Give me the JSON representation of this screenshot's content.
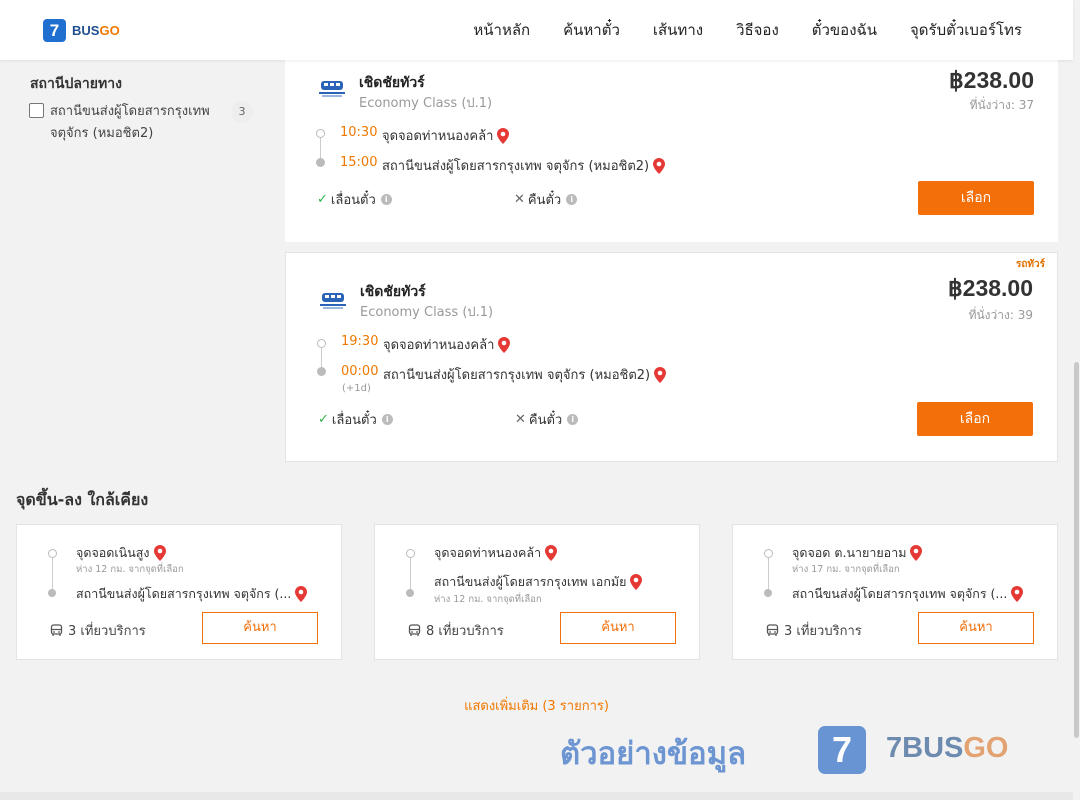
{
  "header": {
    "logo_digit": "7",
    "logo_text": "BUS",
    "logo_text_accent": "GO",
    "nav": [
      "หน้าหลัก",
      "ค้นหาตั๋ว",
      "เส้นทาง",
      "วิธีจอง",
      "ตั๋วของฉัน",
      "จุดรับตั๋วเบอร์โทร"
    ]
  },
  "filter": {
    "title": "สถานีปลายทาง",
    "options": [
      {
        "label": "สถานีขนส่งผู้โดยสารกรุงเทพ จตุจักร (หมอชิต2)",
        "count": "3",
        "checked": false
      }
    ]
  },
  "trips": [
    {
      "operator": "เชิดชัยทัวร์",
      "class": "Economy Class (ป.1)",
      "price": "฿238.00",
      "seats": "ที่นั่งว่าง: 37",
      "tag": "",
      "depart_time": "10:30",
      "depart_stop": "จุดจอดท่าหนองคล้า",
      "arrive_time": "15:00",
      "arrive_stop": "สถานีขนส่งผู้โดยสารกรุงเทพ จตุจักร (หมอชิต2)",
      "next_day": "",
      "reschedule": "เลื่อนตั๋ว",
      "refund": "คืนตั๋ว",
      "select": "เลือก"
    },
    {
      "operator": "เชิดชัยทัวร์",
      "class": "Economy Class (ป.1)",
      "price": "฿238.00",
      "seats": "ที่นั่งว่าง: 39",
      "tag": "รถทัวร์",
      "depart_time": "19:30",
      "depart_stop": "จุดจอดท่าหนองคล้า",
      "arrive_time": "00:00",
      "arrive_stop": "สถานีขนส่งผู้โดยสารกรุงเทพ จตุจักร (หมอชิต2)",
      "next_day": "(+1d)",
      "reschedule": "เลื่อนตั๋ว",
      "refund": "คืนตั๋ว",
      "select": "เลือก"
    }
  ],
  "nearby": {
    "title": "จุดขึ้น-ลง ใกล้เคียง",
    "cards": [
      {
        "from": "จุดจอดเนินสูง",
        "from_sub": "ห่าง 12 กม. จากจุดที่เลือก",
        "to": "สถานีขนส่งผู้โดยสารกรุงเทพ จตุจักร (...",
        "to_sub": "",
        "trips": "3 เที่ยวบริการ",
        "button": "ค้นหา"
      },
      {
        "from": "จุดจอดท่าหนองคล้า",
        "from_sub": "",
        "to": "สถานีขนส่งผู้โดยสารกรุงเทพ เอกมัย",
        "to_sub": "ห่าง 12 กม. จากจุดที่เลือก",
        "trips": "8 เที่ยวบริการ",
        "button": "ค้นหา"
      },
      {
        "from": "จุดจอด ต.นายายอาม",
        "from_sub": "ห่าง 17 กม. จากจุดที่เลือก",
        "to": "สถานีขนส่งผู้โดยสารกรุงเทพ จตุจักร (...",
        "to_sub": "",
        "trips": "3 เที่ยวบริการ",
        "button": "ค้นหา"
      }
    ],
    "show_more": "แสดงเพิ่มเติม (3 รายการ)"
  },
  "watermark": {
    "text": "ตัวอย่างข้อมูล",
    "digit": "7",
    "brand": "7BUS",
    "brand_accent": "GO"
  },
  "colors": {
    "accent": "#f26f0a",
    "brand_blue": "#1f6fd1",
    "pin_red": "#e53935",
    "check_green": "#2bb24c"
  },
  "icons": {
    "pin": "map-pin-icon",
    "check": "check-icon",
    "cross": "cross-icon",
    "info": "info-icon",
    "bus": "bus-icon"
  }
}
